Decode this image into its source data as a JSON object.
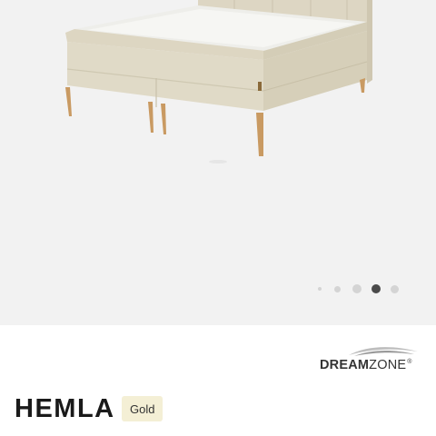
{
  "gallery": {
    "image_alt": "product-photo-bed",
    "dot_count": 5,
    "active_index": 3
  },
  "brand": {
    "name_bold": "DREAM",
    "name_regular": "ZONE",
    "registered": "®"
  },
  "product": {
    "title": "HEMLA",
    "badge": "Gold"
  }
}
